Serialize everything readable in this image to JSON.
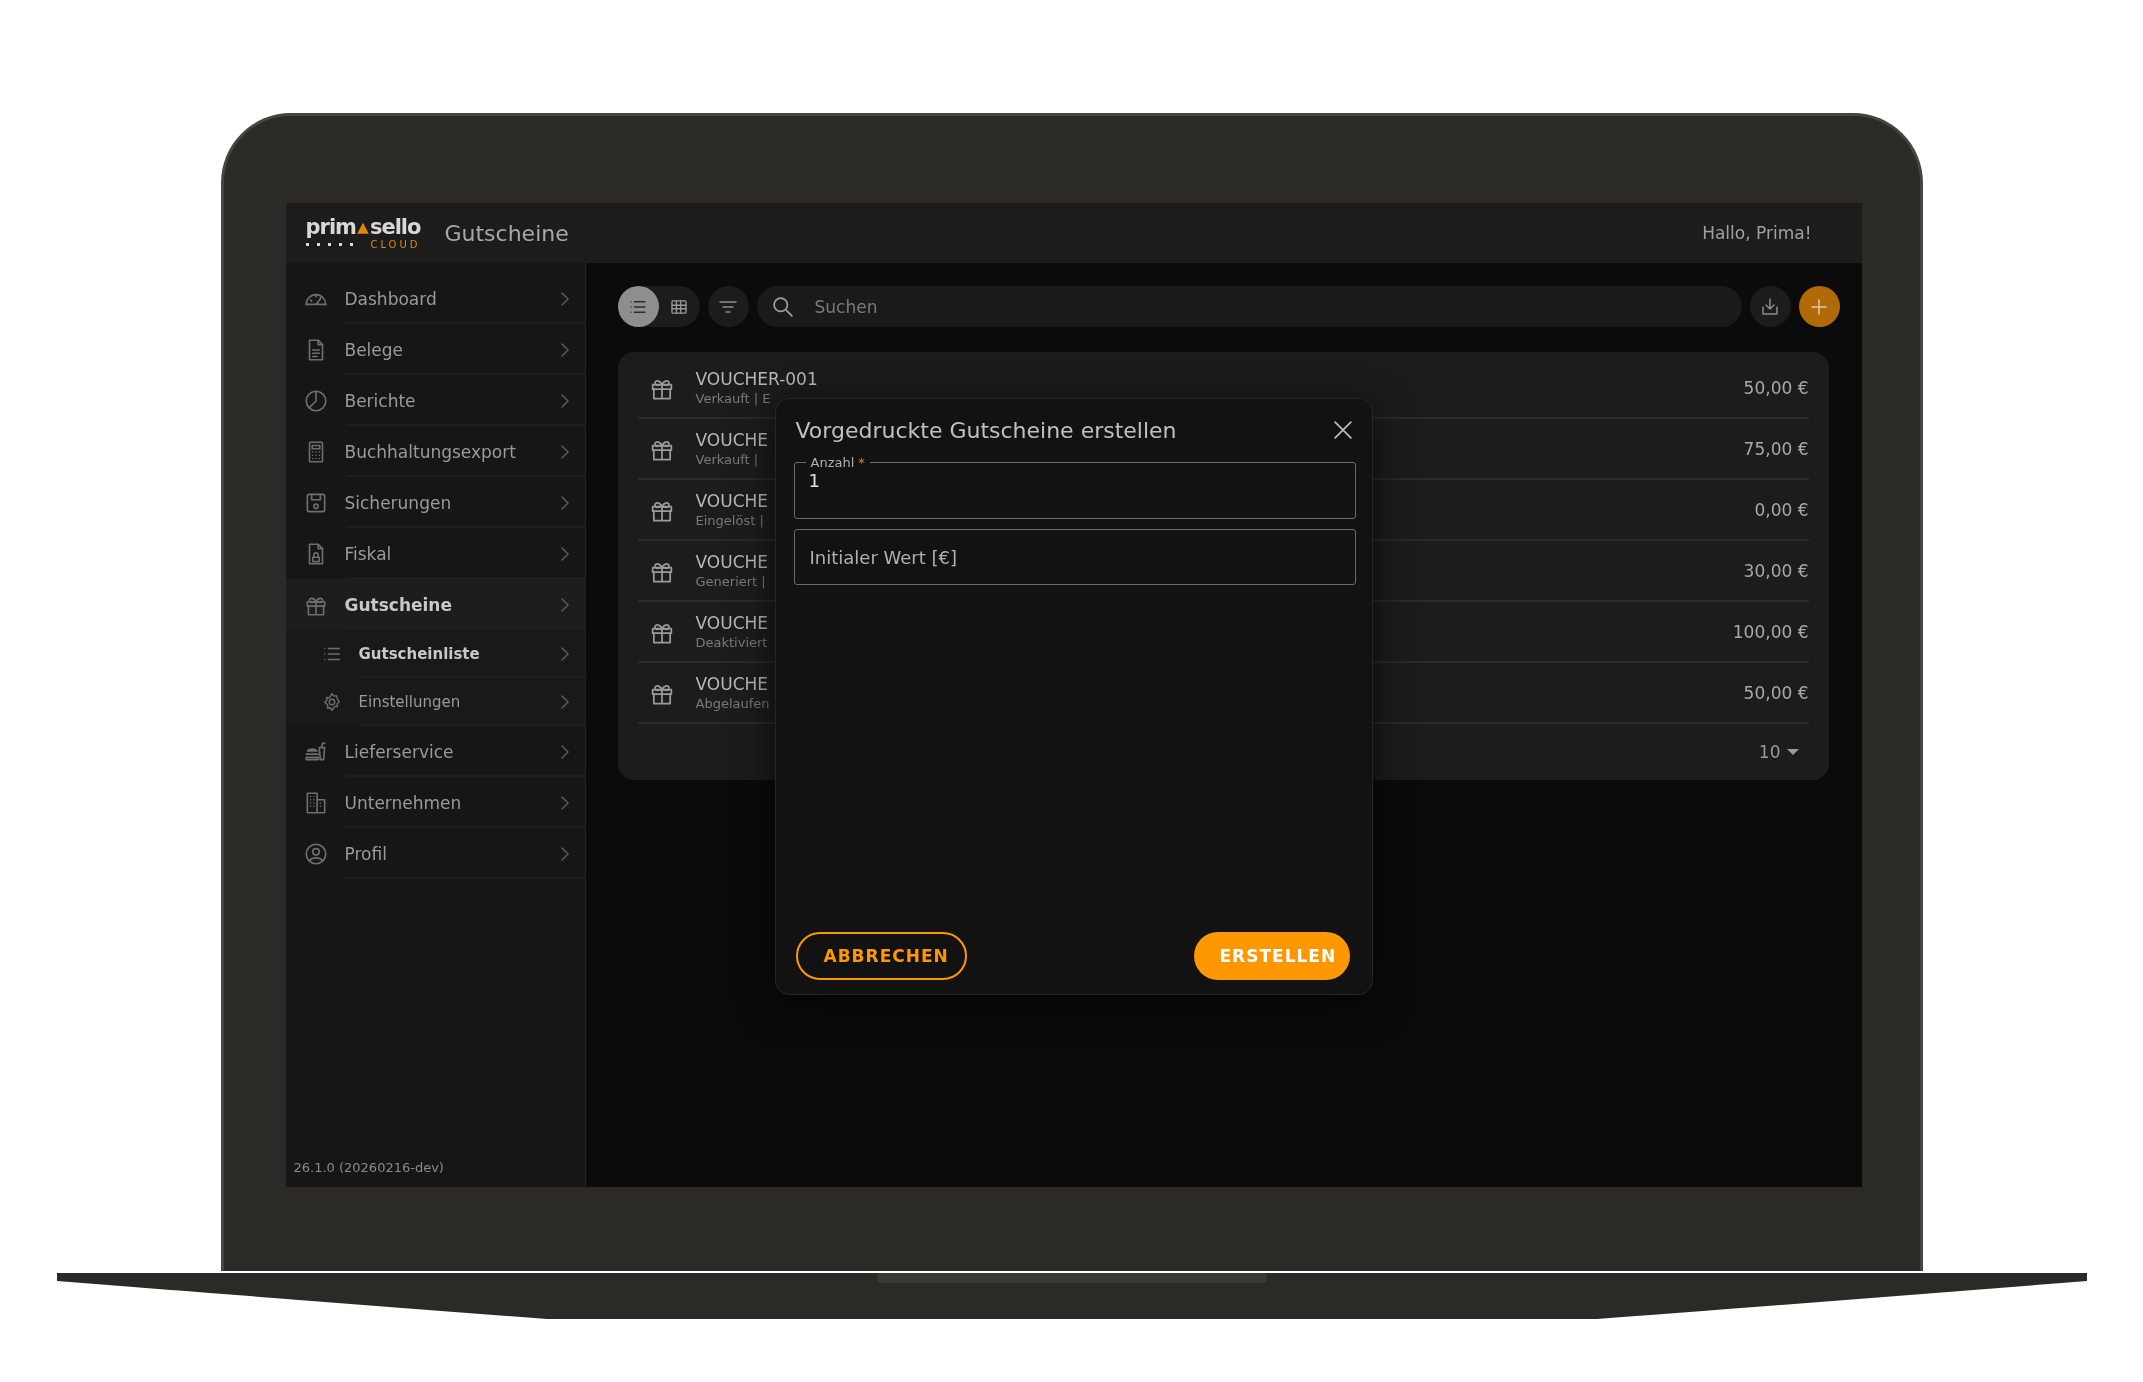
{
  "header": {
    "logo": {
      "word_start": "prim",
      "word_end": "sello",
      "tagline": "CLOUD"
    },
    "title": "Gutscheine",
    "greeting": "Hallo, Prima!"
  },
  "sidebar": {
    "items": [
      {
        "label": "Dashboard",
        "selected": false
      },
      {
        "label": "Belege",
        "selected": false
      },
      {
        "label": "Berichte",
        "selected": false
      },
      {
        "label": "Buchhaltungsexport",
        "selected": false
      },
      {
        "label": "Sicherungen",
        "selected": false
      },
      {
        "label": "Fiskal",
        "selected": false
      },
      {
        "label": "Gutscheine",
        "selected": true,
        "children": [
          {
            "label": "Gutscheinliste",
            "selected": true
          },
          {
            "label": "Einstellungen",
            "selected": false
          }
        ]
      },
      {
        "label": "Lieferservice",
        "selected": false
      },
      {
        "label": "Unternehmen",
        "selected": false
      },
      {
        "label": "Profil",
        "selected": false
      }
    ],
    "version": "26.1.0 (20260216-dev)"
  },
  "toolbar": {
    "views": [
      {
        "kind": "list",
        "selected": true
      },
      {
        "kind": "grid",
        "selected": false
      }
    ],
    "search": {
      "placeholder": "Suchen"
    }
  },
  "vouchers": {
    "rows": [
      {
        "title": "VOUCHER-001",
        "subtitle": "Verkauft | E",
        "amount": "50,00 €"
      },
      {
        "title": "VOUCHE",
        "subtitle": "Verkauft |",
        "amount": "75,00 €"
      },
      {
        "title": "VOUCHE",
        "subtitle": "Eingelöst |",
        "amount": "0,00 €"
      },
      {
        "title": "VOUCHE",
        "subtitle": "Generiert |",
        "amount": "30,00 €"
      },
      {
        "title": "VOUCHE",
        "subtitle": "Deaktiviert",
        "amount": "100,00 €"
      },
      {
        "title": "VOUCHE",
        "subtitle": "Abgelaufen",
        "amount": "50,00 €"
      }
    ],
    "page_size": "10"
  },
  "dialog": {
    "title": "Vorgedruckte Gutscheine erstellen",
    "fields": [
      {
        "label": "Anzahl",
        "required_mark": "*",
        "value": "1"
      },
      {
        "placeholder": "Initialer Wert [€]"
      }
    ],
    "buttons": [
      {
        "label": "ABBRECHEN",
        "kind": "outlined"
      },
      {
        "label": "ERSTELLEN",
        "kind": "filled"
      }
    ]
  }
}
